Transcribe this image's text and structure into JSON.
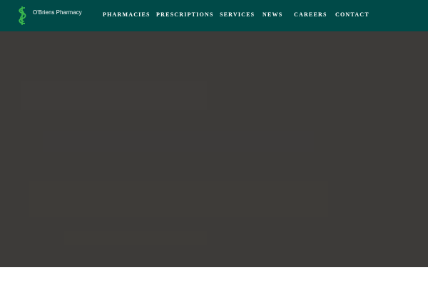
{
  "header": {
    "brand_name": "O'Briens Pharmacy",
    "logo_icon": "pharmacy-logo-icon",
    "background_color": "#004a48",
    "logo_color": "#3dba4e"
  },
  "nav": {
    "items": [
      {
        "label": "PHARMACIES"
      },
      {
        "label": "PRESCRIPTIONS"
      },
      {
        "label": "SERVICES"
      },
      {
        "label": "NEWS"
      },
      {
        "label": "CAREERS"
      },
      {
        "label": "CONTACT"
      }
    ]
  },
  "hero": {
    "background_color": "#3d3b39"
  }
}
